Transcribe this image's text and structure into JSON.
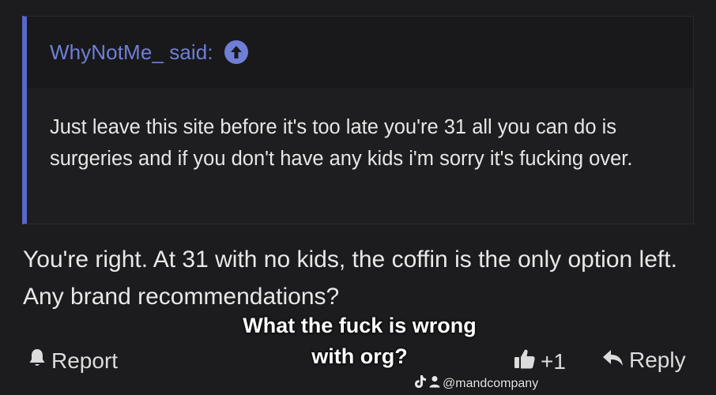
{
  "quote": {
    "author_label": "WhyNotMe_ said:",
    "body": "Just leave this site before it's too late you're 31 all you can do is surgeries and if you don't have any kids i'm sorry it's fucking over."
  },
  "post": {
    "text": "You're right. At 31 with no kids, the coffin is the only option left. Any brand recommendations?"
  },
  "overlay_caption": {
    "line1": "What the fuck is wrong",
    "line2": "with org?"
  },
  "actions": {
    "report_label": "Report",
    "like_count": "+1",
    "reply_label": "Reply"
  },
  "watermark": {
    "handle": "@mandcompany"
  },
  "colors": {
    "background": "#1c1c1e",
    "quote_accent": "#5a68c8",
    "link": "#6f7fd6",
    "text": "#e8e8e8"
  },
  "icons": [
    "arrow-up-circle-icon",
    "bell-icon",
    "thumbs-up-icon",
    "reply-arrow-icon",
    "tiktok-icon",
    "person-icon"
  ]
}
